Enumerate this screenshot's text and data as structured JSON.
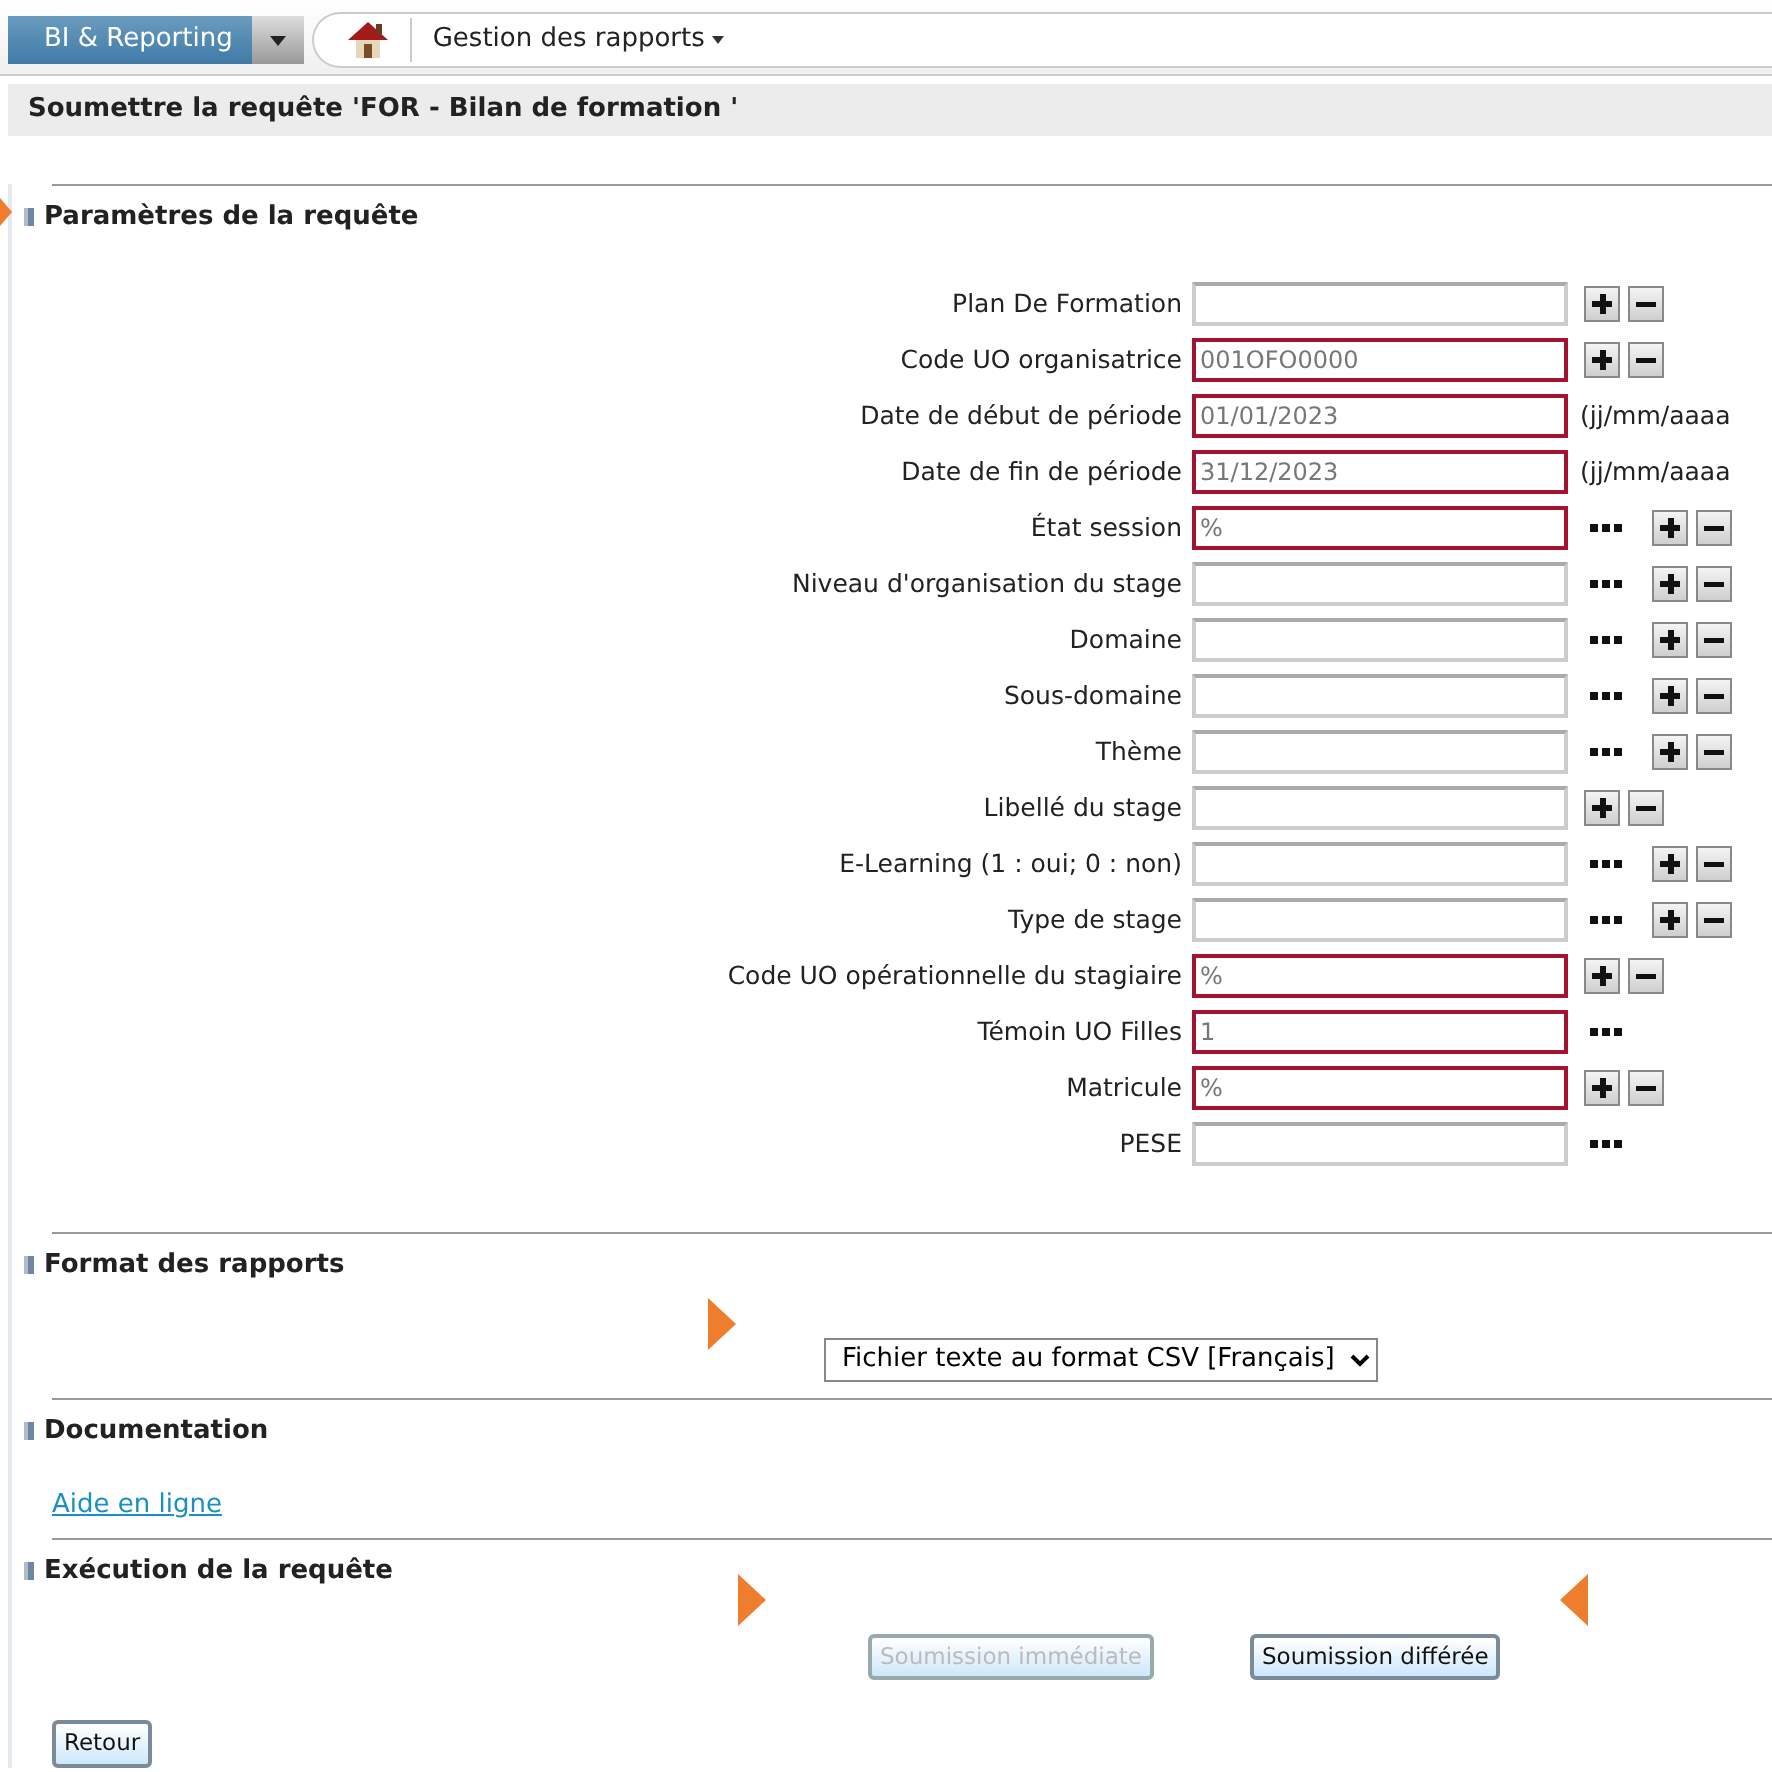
{
  "top_bar": {
    "module_button": "BI & Reporting",
    "menu": "Gestion des rapports"
  },
  "page_title": "Soumettre la requête 'FOR - Bilan de formation '",
  "parameters": {
    "title": "Paramètres de la requête",
    "fields": [
      {
        "label": "Plan De Formation",
        "required": false,
        "browse": false,
        "add_remove": true
      },
      {
        "label": "Code UO organisatrice",
        "value": "001OFO0000",
        "required": true,
        "browse": false,
        "add_remove": true
      },
      {
        "label": "Date de début de période",
        "value": "01/01/2023",
        "required": true,
        "browse": false,
        "add_remove": false,
        "hint": "(jj/mm/aaaa"
      },
      {
        "label": "Date de fin de période",
        "value": "31/12/2023",
        "required": true,
        "browse": false,
        "add_remove": false,
        "hint": "(jj/mm/aaaa"
      },
      {
        "label": "État session",
        "value": "%",
        "required": true,
        "browse": true,
        "add_remove": true
      },
      {
        "label": "Niveau d'organisation du stage",
        "required": false,
        "browse": true,
        "add_remove": true
      },
      {
        "label": "Domaine",
        "required": false,
        "browse": true,
        "add_remove": true
      },
      {
        "label": "Sous-domaine",
        "required": false,
        "browse": true,
        "add_remove": true
      },
      {
        "label": "Thème",
        "required": false,
        "browse": true,
        "add_remove": true
      },
      {
        "label": "Libellé du stage",
        "required": false,
        "browse": false,
        "add_remove": true
      },
      {
        "label": "E-Learning (1 : oui; 0 : non)",
        "required": false,
        "browse": true,
        "add_remove": true
      },
      {
        "label": "Type de stage",
        "required": false,
        "browse": true,
        "add_remove": true
      },
      {
        "label": "Code UO opérationnelle du stagiaire",
        "value": "%",
        "required": true,
        "browse": false,
        "add_remove": true
      },
      {
        "label": "Témoin UO Filles",
        "value": "1",
        "required": true,
        "browse": true,
        "add_remove": false
      },
      {
        "label": "Matricule",
        "value": "%",
        "required": true,
        "browse": false,
        "add_remove": true
      },
      {
        "label": "PESE",
        "required": false,
        "browse": true,
        "add_remove": false
      }
    ]
  },
  "format": {
    "title": "Format des rapports",
    "selected_format": "Fichier texte au format CSV [Français]"
  },
  "documentation": {
    "title": "Documentation",
    "link": "Aide en ligne"
  },
  "execution": {
    "title": "Exécution de la requête",
    "buttons": [
      {
        "label": "Soumission immédiate",
        "disabled": true
      },
      {
        "label": "Soumission différée",
        "disabled": false
      }
    ]
  },
  "back_button": "Retour"
}
